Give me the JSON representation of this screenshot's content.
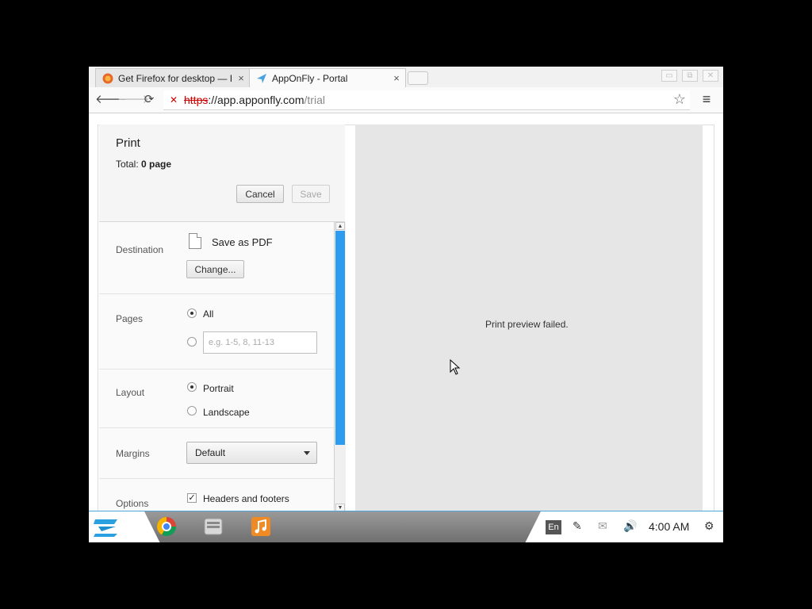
{
  "browser": {
    "tabs": [
      {
        "title": "Get Firefox for desktop — I",
        "favicon": "firefox-icon",
        "active": false
      },
      {
        "title": "AppOnFly - Portal",
        "favicon": "apponfly-icon",
        "active": true
      }
    ],
    "url": {
      "scheme": "https",
      "host": "://app.apponfly.com",
      "path": "/trial"
    }
  },
  "print": {
    "title": "Print",
    "total_label": "Total: ",
    "total_value": "0 page",
    "cancel_label": "Cancel",
    "save_label": "Save",
    "destination": {
      "label": "Destination",
      "value": "Save as PDF",
      "change_label": "Change..."
    },
    "pages": {
      "label": "Pages",
      "all_label": "All",
      "custom_placeholder": "e.g. 1-5, 8, 11-13",
      "selected": "All"
    },
    "layout": {
      "label": "Layout",
      "options": [
        "Portrait",
        "Landscape"
      ],
      "selected": "Portrait"
    },
    "margins": {
      "label": "Margins",
      "value": "Default"
    },
    "options": {
      "label": "Options",
      "headers_footers_label": "Headers and footers",
      "headers_footers_checked": true
    }
  },
  "preview": {
    "message": "Print preview failed."
  },
  "taskbar": {
    "apps": [
      "zorin-logo-icon",
      "chrome-icon",
      "file-manager-icon",
      "music-player-icon"
    ],
    "language": "En",
    "clock": "4:00 AM"
  },
  "colors": {
    "accent": "#2d9cf0",
    "taskbar_border": "#4ca8d8"
  }
}
